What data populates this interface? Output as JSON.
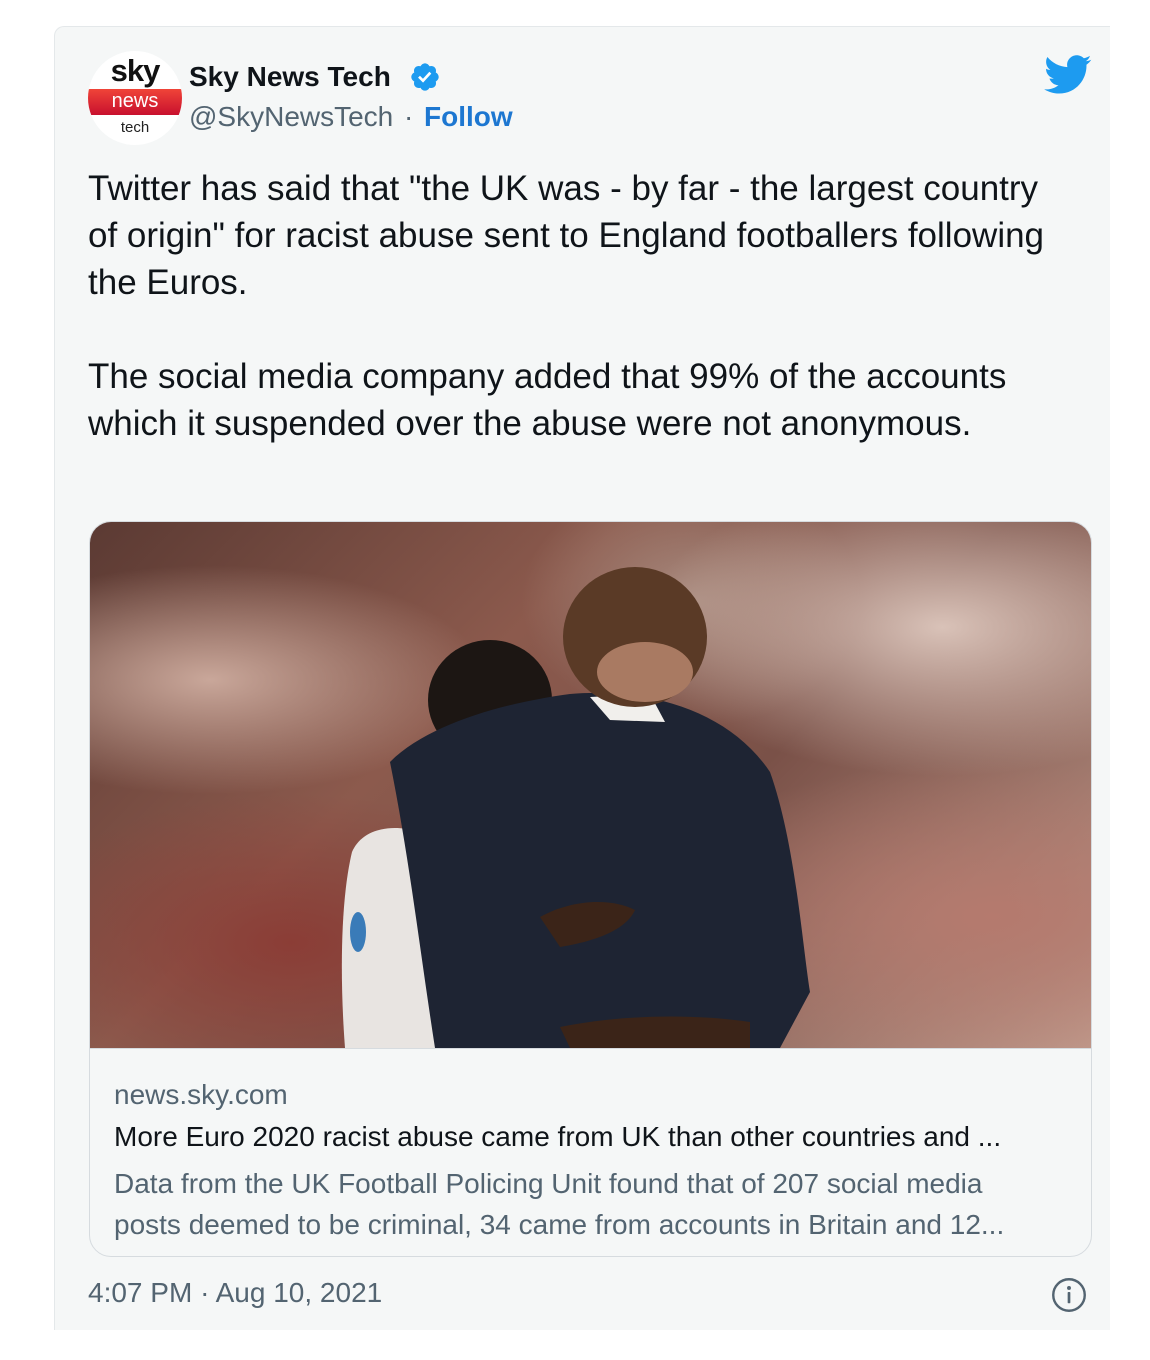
{
  "author": {
    "avatar_logo": {
      "line1": "sky",
      "line2": "news",
      "line3": "tech"
    },
    "name": "Sky News Tech",
    "handle": "@SkyNewsTech",
    "separator": "·",
    "follow_label": "Follow",
    "verified_icon": "verified-badge",
    "brand_icon": "twitter-bird"
  },
  "tweet": {
    "paragraphs": [
      "Twitter has said that \"the UK was - by far - the largest country of origin\" for racist abuse sent to England footballers following the Euros.",
      "The social media company added that 99% of the accounts which it suspended over the abuse were not anonymous."
    ]
  },
  "card": {
    "domain": "news.sky.com",
    "title": "More Euro 2020 racist abuse came from UK than other countries and ...",
    "description_lines": [
      "Data from the UK Football Policing Unit found that of 207 social media",
      "posts deemed to be criminal, 34 came from accounts in Britain and 12..."
    ]
  },
  "footer": {
    "time": "4:07 PM",
    "separator": "·",
    "date": "Aug 10, 2021",
    "info_icon": "info-circle"
  },
  "colors": {
    "accent": "#1d77d1",
    "twitter_blue": "#1d9bf0",
    "secondary_text": "#536471",
    "card_bg": "#f5f7f7"
  }
}
